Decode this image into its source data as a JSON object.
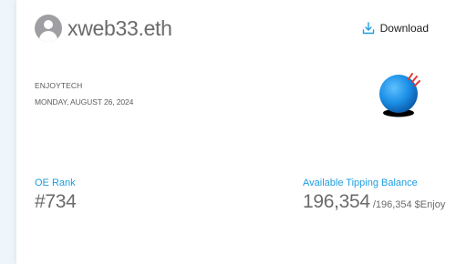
{
  "profile": {
    "username": "xweb33.eth"
  },
  "toolbar": {
    "download_label": "Download"
  },
  "meta": {
    "brand": "ENJOYTECH",
    "date": "MONDAY, AUGUST 26, 2024"
  },
  "stats": {
    "rank_label": "OE Rank",
    "rank_value": "#734",
    "balance_label": "Available Tipping Balance",
    "balance_value": "196,354",
    "balance_total": "/196,354 $Enjoy"
  },
  "colors": {
    "accent": "#1e9ee0",
    "text": "#6b6b6b",
    "logo_ball": "#1b8fe6",
    "logo_mark": "#e53935"
  },
  "icons": {
    "avatar": "default-user-avatar",
    "download": "download-icon",
    "logo": "blue-ball-logo"
  }
}
